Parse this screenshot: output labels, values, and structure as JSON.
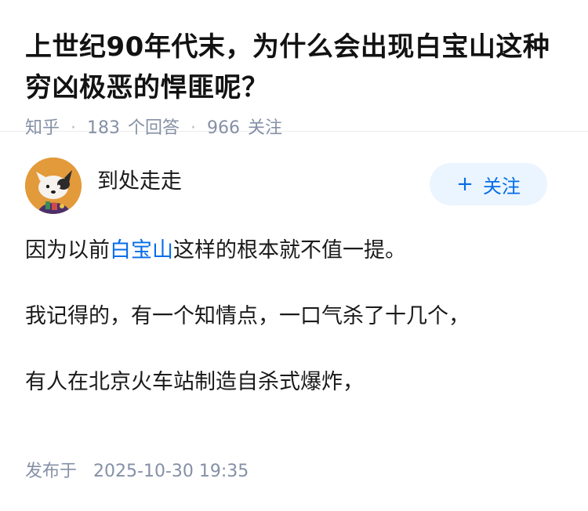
{
  "question": {
    "title": "上世纪90年代末，为什么会出现白宝山这种穷凶极恶的悍匪呢？",
    "source": "知乎",
    "answer_count": "183",
    "answer_label": "个回答",
    "follower_count": "966",
    "follower_label": "关注"
  },
  "answer": {
    "author": {
      "name": "到处走走",
      "avatar_icon": "dog-avatar-icon"
    },
    "follow_button": {
      "icon": "+",
      "label": "关注"
    },
    "paragraph1": {
      "before": "因为以前",
      "link": "白宝山",
      "after": "这样的根本就不值一提。"
    },
    "paragraph2": "我记得的，有一个知情点，一口气杀了十几个，",
    "paragraph3": "有人在北京火车站制造自杀式爆炸，",
    "published_label": "发布于",
    "published_time": "2025-10-30 19:35"
  },
  "colors": {
    "link": "#056de8",
    "meta": "#8590a6",
    "follow_bg": "#ebf5ff"
  }
}
